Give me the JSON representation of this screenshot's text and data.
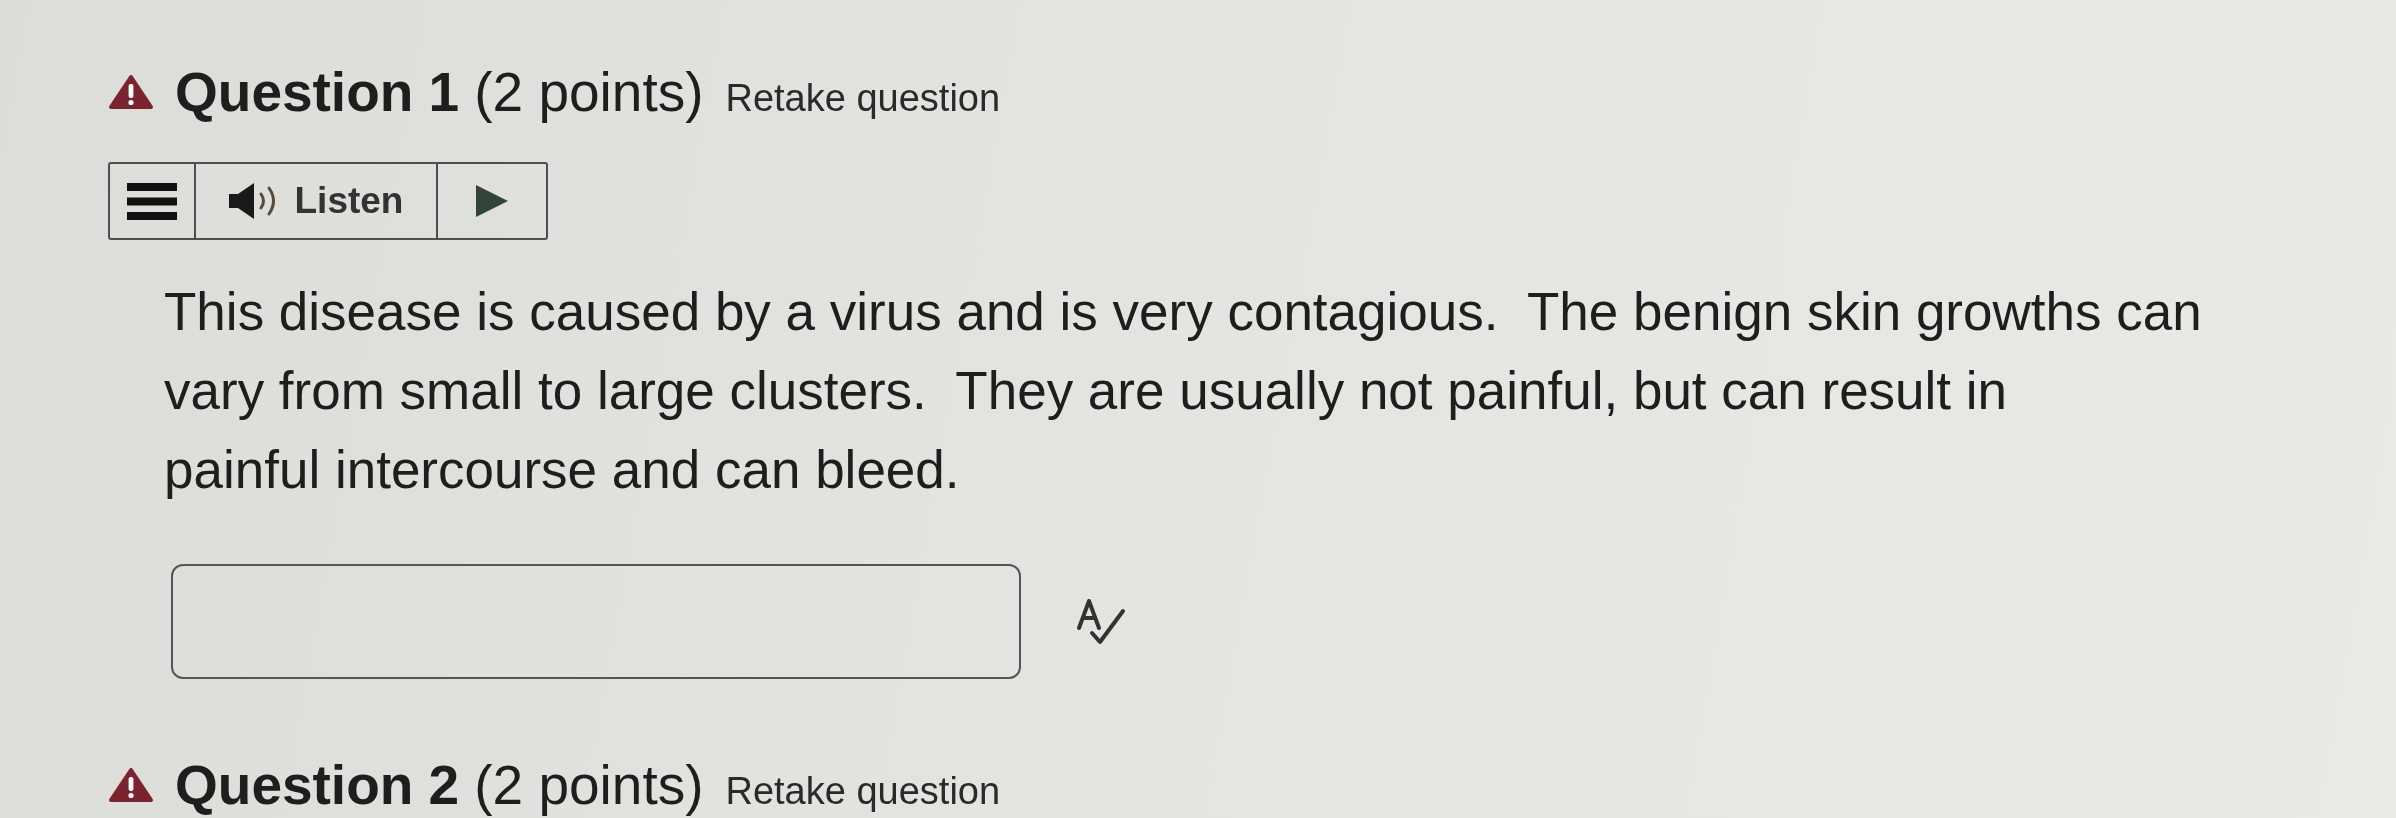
{
  "question": {
    "warning": true,
    "title": "Question 1",
    "points": "(2 points)",
    "status": "Retake question",
    "reader": {
      "label": "Listen"
    },
    "prompt": [
      "This disease is caused by a virus and is very contagious.  The benign skin growths can",
      "vary from small to large clusters.  They are usually not painful, but can result in",
      "painful intercourse and can bleed."
    ],
    "answer": {
      "spellcheck": true
    }
  },
  "next_question": {
    "warning": true,
    "title": "Question 2",
    "points": "(2 points)",
    "status": "Retake question"
  }
}
